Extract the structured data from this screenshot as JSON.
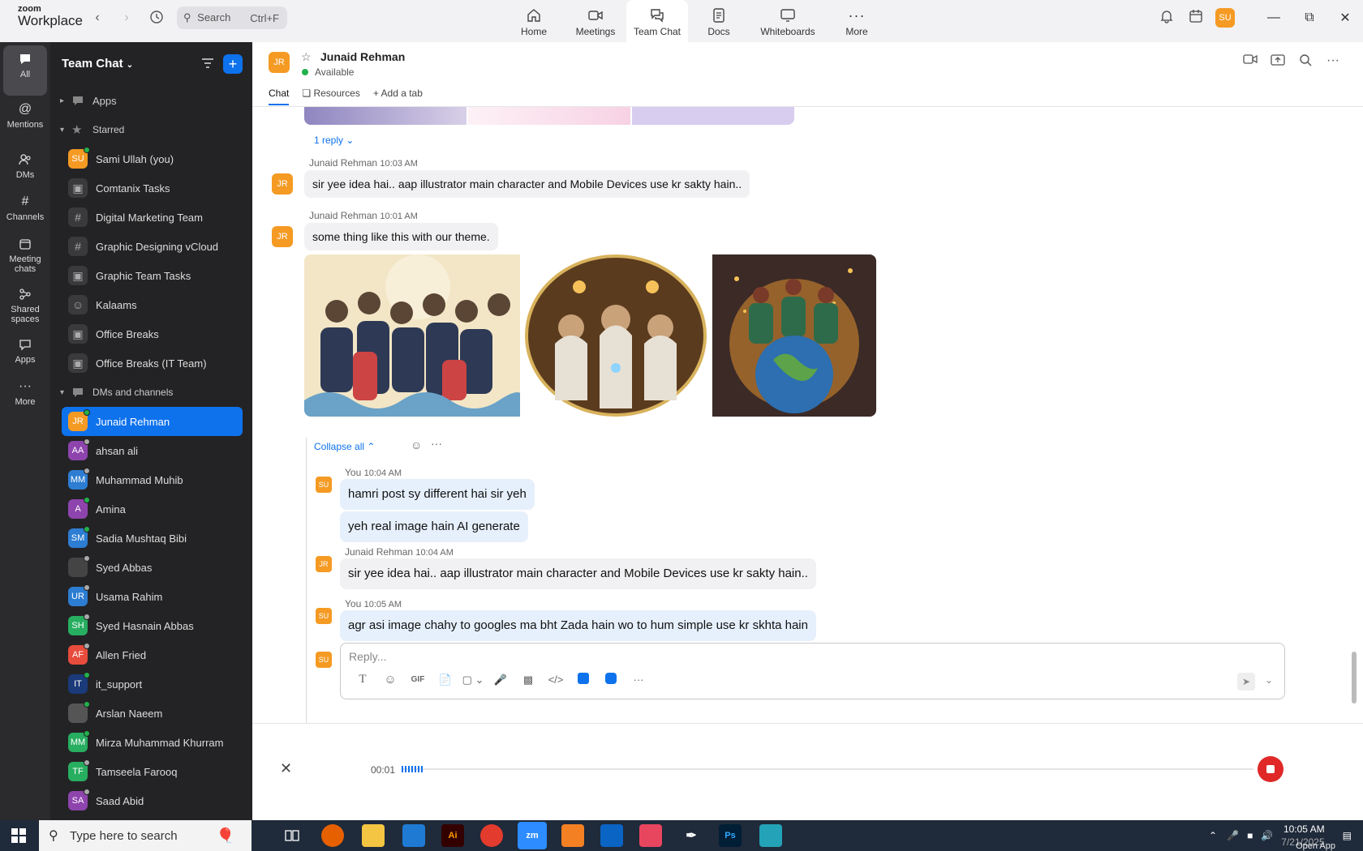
{
  "app": {
    "brand_top": "zoom",
    "brand_bottom": "Workplace"
  },
  "search": {
    "placeholder": "Search",
    "shortcut": "Ctrl+F"
  },
  "nav": [
    {
      "label": "Home",
      "icon": "home-icon"
    },
    {
      "label": "Meetings",
      "icon": "video-icon"
    },
    {
      "label": "Team Chat",
      "icon": "chat-icon",
      "active": true
    },
    {
      "label": "Docs",
      "icon": "doc-icon"
    },
    {
      "label": "Whiteboards",
      "icon": "whiteboard-icon"
    },
    {
      "label": "More",
      "icon": "more-icon"
    }
  ],
  "user": {
    "initials": "SU",
    "color": "#f59a23"
  },
  "rail": [
    {
      "label": "All",
      "icon": "chat-bubble-icon"
    },
    {
      "label": "Mentions",
      "icon": "at-icon"
    },
    {
      "label": "DMs",
      "icon": "people-icon"
    },
    {
      "label": "Channels",
      "icon": "hash-icon"
    },
    {
      "label": "Meeting chats",
      "icon": "calendar-icon"
    },
    {
      "label": "Shared spaces",
      "icon": "share-icon"
    },
    {
      "label": "Apps",
      "icon": "apps-icon"
    },
    {
      "label": "More",
      "icon": "more-icon"
    }
  ],
  "sidebar": {
    "title": "Team Chat",
    "apps_label": "Apps",
    "starred_label": "Starred",
    "starred": [
      {
        "label": "Sami Ullah (you)",
        "type": "avatar",
        "initials": "SU",
        "color": "#f59a23",
        "status": "#22b14c"
      },
      {
        "label": "Comtanix Tasks",
        "type": "lock"
      },
      {
        "label": "Digital Marketing Team",
        "type": "hash"
      },
      {
        "label": "Graphic Designing vCloud",
        "type": "hash"
      },
      {
        "label": "Graphic Team Tasks",
        "type": "lock"
      },
      {
        "label": "Kalaams",
        "type": "group"
      },
      {
        "label": "Office Breaks",
        "type": "lock"
      },
      {
        "label": "Office Breaks (IT Team)",
        "type": "lock"
      }
    ],
    "dms_label": "DMs and channels",
    "dms": [
      {
        "label": "Junaid Rehman",
        "initials": "JR",
        "color": "#f59a23",
        "status": "#22b14c",
        "selected": true
      },
      {
        "label": "ahsan ali",
        "initials": "AA",
        "color": "#8e44ad",
        "status": "#aaaaaa"
      },
      {
        "label": "Muhammad Muhib",
        "initials": "MM",
        "color": "#2d7dd2",
        "status": "#aaaaaa"
      },
      {
        "label": "Amina",
        "initials": "A",
        "color": "#8e44ad",
        "status": "#22b14c"
      },
      {
        "label": "Sadia Mushtaq Bibi",
        "initials": "SM",
        "color": "#2d7dd2",
        "status": "#22b14c"
      },
      {
        "label": "Syed Abbas",
        "initials": "",
        "color": "#444444",
        "status": "#aaaaaa"
      },
      {
        "label": "Usama Rahim",
        "initials": "UR",
        "color": "#2d7dd2",
        "status": "#aaaaaa"
      },
      {
        "label": "Syed Hasnain Abbas",
        "initials": "SH",
        "color": "#27ae60",
        "status": "#aaaaaa"
      },
      {
        "label": "Allen Fried",
        "initials": "AF",
        "color": "#e74c3c",
        "status": "#aaaaaa"
      },
      {
        "label": "it_support",
        "initials": "IT",
        "color": "#1a3a7a",
        "status": "#22b14c"
      },
      {
        "label": "Arslan Naeem",
        "initials": "",
        "color": "#555555",
        "status": "#22b14c"
      },
      {
        "label": "Mirza Muhammad Khurram",
        "initials": "MM",
        "color": "#27ae60",
        "status": "#22b14c"
      },
      {
        "label": "Tamseela Farooq",
        "initials": "TF",
        "color": "#27ae60",
        "status": "#aaaaaa"
      },
      {
        "label": "Saad Abid",
        "initials": "SA",
        "color": "#8e44ad",
        "status": "#aaaaaa"
      }
    ]
  },
  "chat": {
    "name": "Junaid Rehman",
    "initials": "JR",
    "status": "Available",
    "tabs": [
      "Chat",
      "Resources",
      "Add a tab"
    ],
    "reply_count": "1 reply",
    "messages": [
      {
        "sender": "Junaid Rehman",
        "time": "10:03 AM",
        "text": "sir yee idea hai.. aap illustrator main character and Mobile Devices use kr sakty hain.."
      },
      {
        "sender": "Junaid Rehman",
        "time": "10:01 AM",
        "text": "some thing like this with our theme."
      }
    ],
    "collapse_label": "Collapse all",
    "thread": [
      {
        "sender": "You",
        "time": "10:04 AM",
        "texts": [
          "hamri post sy different hai sir yeh",
          "yeh real image hain AI generate"
        ]
      },
      {
        "sender": "Junaid Rehman",
        "time": "10:04 AM",
        "texts": [
          "sir yee idea hai.. aap illustrator main character and Mobile Devices use kr sakty hain.."
        ]
      },
      {
        "sender": "You",
        "time": "10:05 AM",
        "texts": [
          "agr asi image chahy to googles ma bht Zada hain wo to hum simple use kr skhta hain"
        ]
      }
    ],
    "reply_placeholder": "Reply...",
    "recording_time": "00:01"
  },
  "taskbar": {
    "search_placeholder": "Type here to search",
    "time": "10:05 AM",
    "date": "7/21/2025",
    "overflow": "Open App"
  }
}
